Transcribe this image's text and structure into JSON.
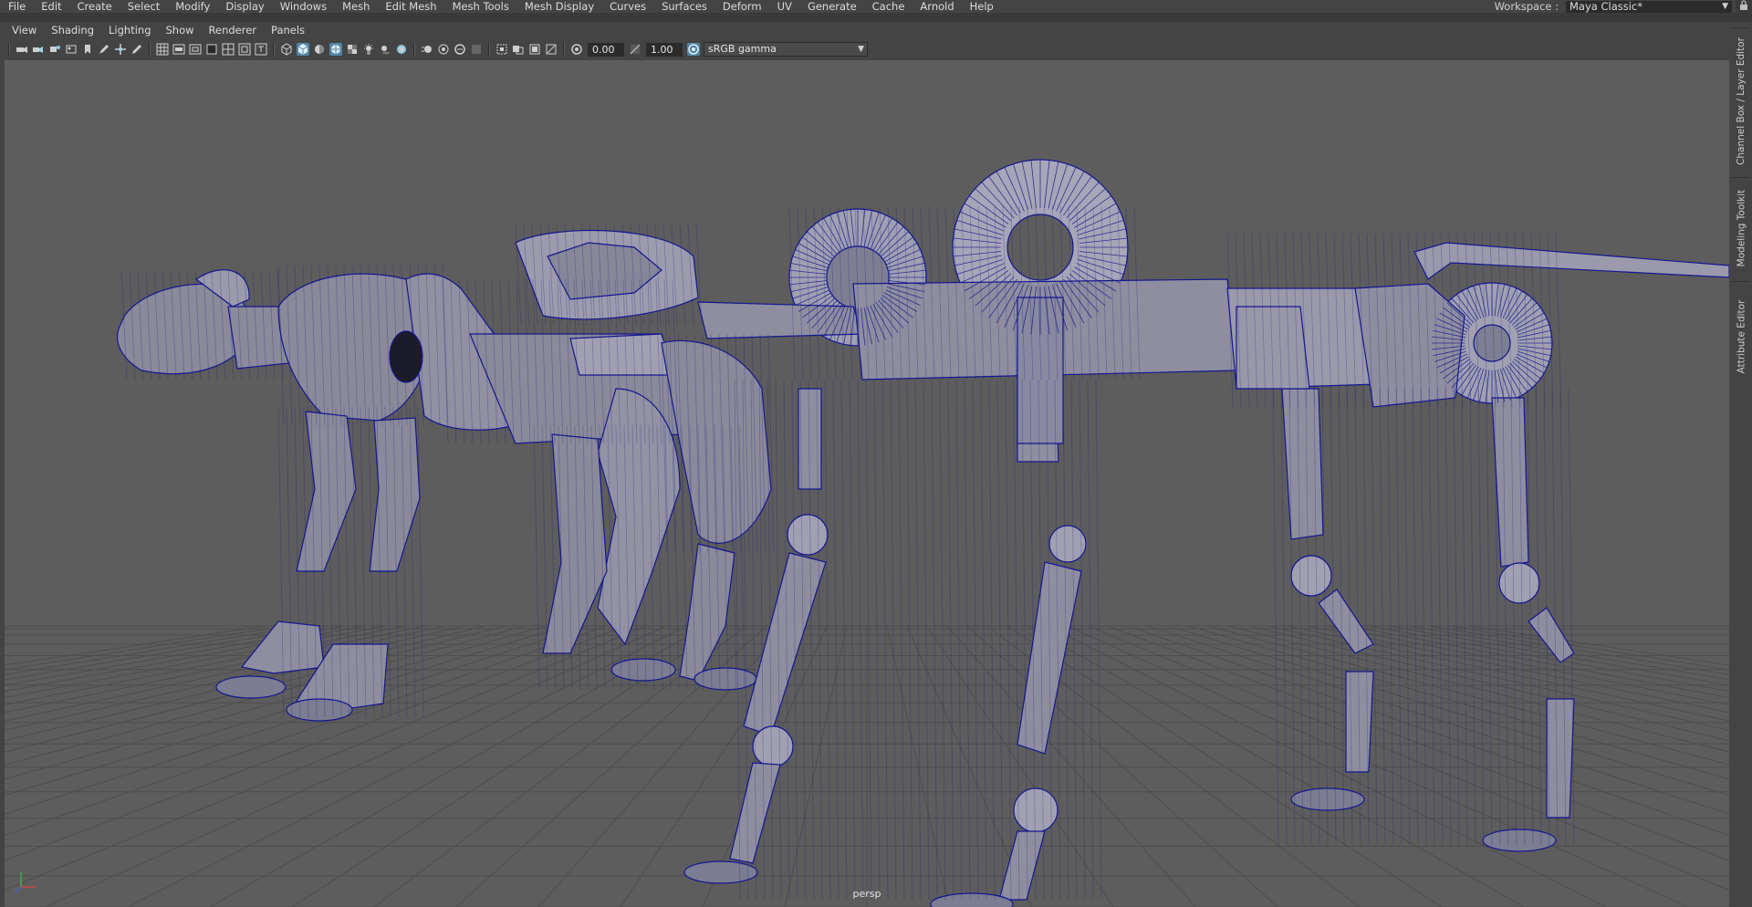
{
  "menu": [
    "File",
    "Edit",
    "Create",
    "Select",
    "Modify",
    "Display",
    "Windows",
    "Mesh",
    "Edit Mesh",
    "Mesh Tools",
    "Mesh Display",
    "Curves",
    "Surfaces",
    "Deform",
    "UV",
    "Generate",
    "Cache",
    "Arnold",
    "Help"
  ],
  "workspace": {
    "label": "Workspace :",
    "value": "Maya Classic*"
  },
  "panel_menu": [
    "View",
    "Shading",
    "Lighting",
    "Show",
    "Renderer",
    "Panels"
  ],
  "toolbar": {
    "exposure": "0.00",
    "gamma": "1.00",
    "color_space": "sRGB gamma"
  },
  "viewport": {
    "camera": "persp",
    "wireframe_color": "#1a1a8c",
    "background": "#5d5d5d"
  },
  "side_tabs": [
    "Channel Box / Layer Editor",
    "Modeling Toolkit",
    "Attribute Editor"
  ],
  "colors": {
    "accent": "#5285a6",
    "ui_bg": "#444444"
  }
}
